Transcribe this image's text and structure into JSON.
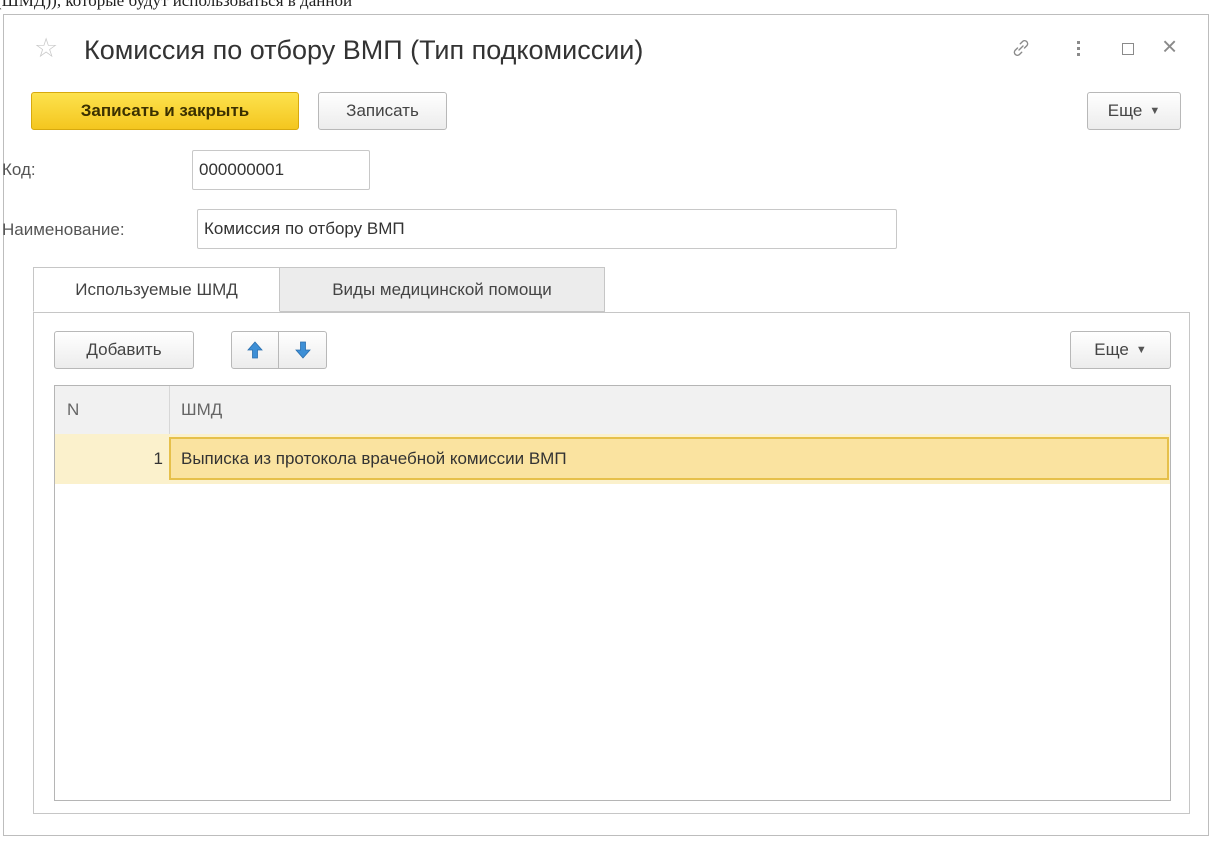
{
  "doc_text": "(ШМД)), которые будут использоваться в данной",
  "window": {
    "title": "Комиссия по отбору ВМП (Тип подкомиссии)",
    "icons": {
      "favorite": "star-icon",
      "link": "link-icon",
      "more": "more-icon",
      "maximize": "maximize-icon",
      "close": "close-icon"
    }
  },
  "toolbar": {
    "save_close_label": "Записать и закрыть",
    "save_label": "Записать",
    "more_label": "Еще"
  },
  "form": {
    "code_label": "Код:",
    "code_value": "000000001",
    "name_label": "Наименование:",
    "name_value": "Комиссия по отбору ВМП"
  },
  "tabs": [
    {
      "label": "Используемые ШМД",
      "active": true
    },
    {
      "label": "Виды медицинской помощи",
      "active": false
    }
  ],
  "table_toolbar": {
    "add_label": "Добавить",
    "more_label": "Еще"
  },
  "table": {
    "columns": [
      "N",
      "ШМД"
    ],
    "rows": [
      {
        "n": "1",
        "shmd": "Выписка из протокола врачебной комиссии ВМП"
      }
    ]
  },
  "colors": {
    "primary_button": "#f4c61f",
    "selected_row": "#fbf1cc",
    "arrow_icon": "#3d8fd6"
  }
}
